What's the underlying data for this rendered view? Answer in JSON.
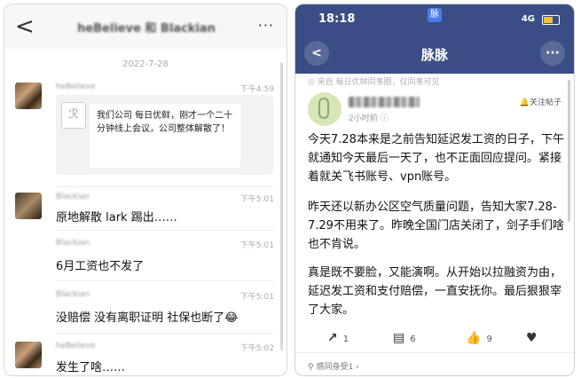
{
  "left": {
    "back": "<",
    "title": "heBelieve 和 Blackian",
    "more": "···",
    "date": "2022-7-28",
    "messages": [
      {
        "name": "heBelieve",
        "time": "下午4:59"
      },
      {
        "name": "Blackian",
        "time": "下午5:01",
        "text": "原地解散 lark 踢出……"
      },
      {
        "name": "Blackian",
        "time": "下午5:01",
        "text": "6月工资也不发了"
      },
      {
        "name": "Blackian",
        "time": "下午5:01",
        "text": "没赔偿 没有离职证明 社保也断了😂"
      },
      {
        "name": "heBelieve",
        "time": "下午5:02",
        "text": "发生了啥……"
      }
    ],
    "card": {
      "icon": "ℛ",
      "text": "我们公司 每日优鲜，刚才一个二十分钟线上会议，公司整体解散了！"
    }
  },
  "right": {
    "status_time": "18:18",
    "status_badge": "脉",
    "status_net": "4G",
    "back": "<",
    "title": "脉脉",
    "more": "···",
    "source": "◎ 来自 每日优鲜同事圈，仅同事可见",
    "post_time": "2小时前 ⓘ",
    "follow": "🔔关注帖子",
    "paragraphs": [
      "今天7.28本来是之前告知延迟发工资的日子，下午就通知今天最后一天了，也不正面回应提问。紧接着就关飞书账号、vpn账号。",
      "昨天还以新办公区空气质量问题，告知大家7.28-7.29不用来了。昨晚全国门店关闭了，剑子手们啥也不肯说。",
      "真是既不要脸，又能演啊。从开始以拉融资为由，延迟发工资和支付赔偿，一直安抚你。最后狠狠宰了大家。"
    ],
    "actions": {
      "share": "1",
      "comment": "6",
      "like": "9"
    },
    "footer": "⚲ 感同身受1 ›"
  }
}
